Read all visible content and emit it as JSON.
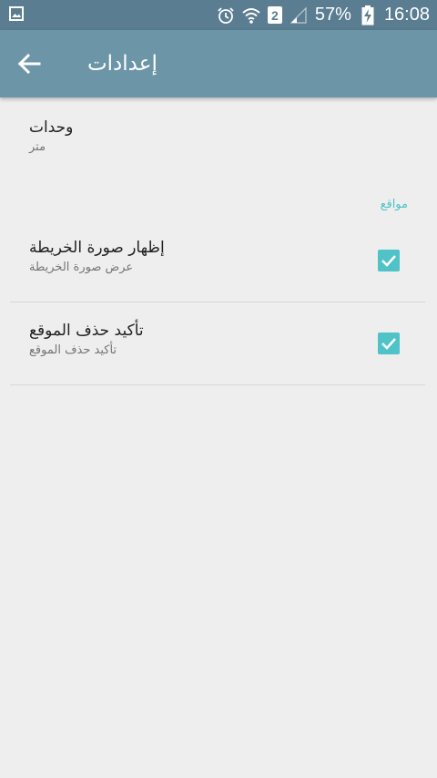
{
  "status_bar": {
    "battery": "57%",
    "time": "16:08",
    "sim_slot": "2",
    "icons": [
      "image-icon",
      "alarm-icon",
      "wifi-icon",
      "signal-icon",
      "battery-charging-icon"
    ]
  },
  "app_bar": {
    "title": "إعدادات",
    "back_icon": "arrow-left-icon"
  },
  "preferences": {
    "units": {
      "title": "وحدات",
      "summary": "متر"
    },
    "category_locations": "مواقع",
    "show_map_image": {
      "title": "إظهار صورة الخريطة",
      "summary": "عرض صورة الخريطة",
      "checked": true
    },
    "confirm_delete_location": {
      "title": "تأكيد حذف الموقع",
      "summary": "تأكيد حذف الموقع",
      "checked": true
    }
  },
  "colors": {
    "status_bar": "#5a7d91",
    "app_bar": "#6c95a8",
    "accent": "#4fc3c8",
    "background": "#eeeeee"
  }
}
